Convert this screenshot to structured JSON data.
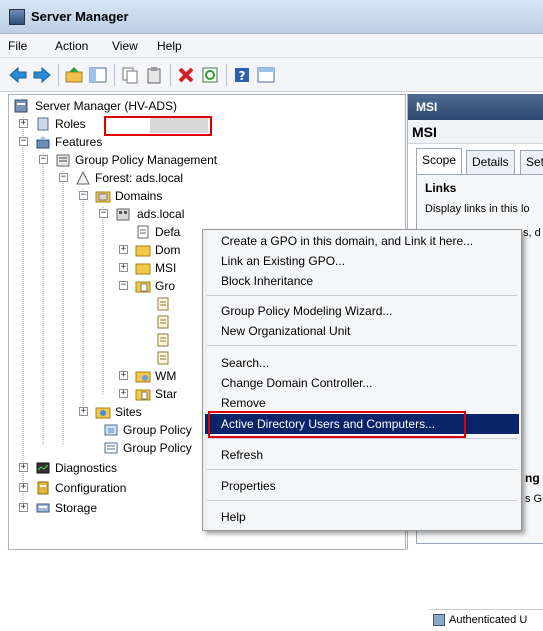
{
  "window": {
    "title": "Server Manager"
  },
  "menu": [
    "File",
    "Action",
    "View",
    "Help"
  ],
  "toolbar_icons": [
    "back-arrow-icon",
    "forward-arrow-icon",
    "up-folder-icon",
    "show-hide-tree-icon",
    "copy-icon",
    "paste-icon",
    "delete-icon",
    "refresh-icon",
    "help-icon",
    "properties-icon"
  ],
  "tree": {
    "root": "Server Manager (HV-ADS)",
    "roles": "Roles",
    "features": "Features",
    "gpm": "Group Policy Management",
    "forest": "Forest: ads.local",
    "domains": "Domains",
    "ads_local": "ads.local",
    "child_def": "Defa",
    "child_dom": "Dom",
    "child_msi": "MSI",
    "child_gro": "Gro",
    "child_wm": "WM",
    "child_star": "Star",
    "sites": "Sites",
    "gp1": "Group Policy",
    "gp2": "Group Policy",
    "diagnostics": "Diagnostics",
    "configuration": "Configuration",
    "storage": "Storage"
  },
  "right_pane": {
    "header": "MSI",
    "title": "MSI",
    "tabs": [
      "Scope",
      "Details",
      "Set"
    ],
    "links_heading": "Links",
    "links_text": "Display links in this lo",
    "frag_sd": "s, d",
    "frag_ng": "ng",
    "frag_sg": "s G",
    "bottom_item": "Authenticated U"
  },
  "context_menu": {
    "items": [
      "Create a GPO in this domain, and Link it here...",
      "Link an Existing GPO...",
      "Block Inheritance",
      "Group Policy Modeling Wizard...",
      "New Organizational Unit",
      "Search...",
      "Change Domain Controller...",
      "Remove",
      "Active Directory Users and Computers...",
      "Refresh",
      "Properties",
      "Help"
    ],
    "highlighted": "Active Directory Users and Computers..."
  },
  "colors": {
    "highlight": "#0a246a",
    "annotation_red": "#e00000",
    "header_blue": "#2e4a70"
  }
}
